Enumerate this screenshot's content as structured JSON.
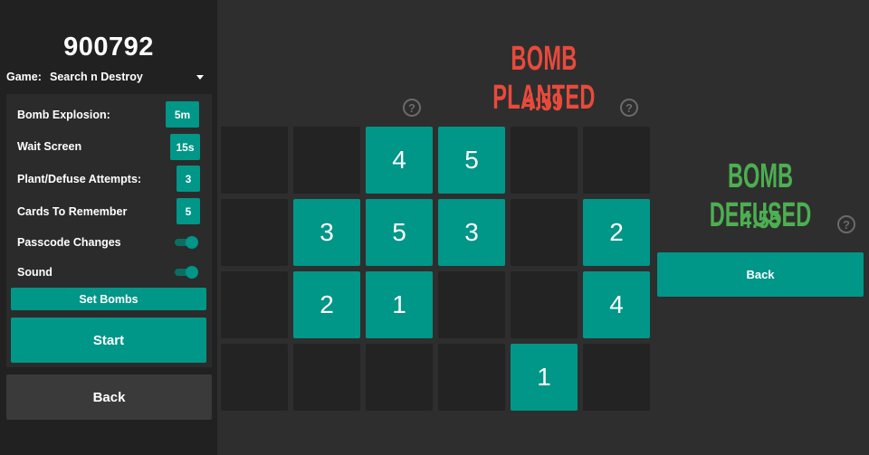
{
  "sidebar": {
    "game_id": "900792",
    "game_label": "Game:",
    "game_value": "Search n Destroy",
    "settings": [
      {
        "label": "Bomb Explosion:",
        "value": "5m"
      },
      {
        "label": "Wait Screen",
        "value": "15s"
      },
      {
        "label": "Plant/Defuse Attempts:",
        "value": "3"
      },
      {
        "label": "Cards To Remember",
        "value": "5"
      }
    ],
    "toggles": [
      {
        "label": "Passcode Changes",
        "on": true
      },
      {
        "label": "Sound",
        "on": true
      }
    ],
    "set_bombs_label": "Set Bombs",
    "start_label": "Start",
    "back_label": "Back"
  },
  "planted": {
    "title": "BOMB PLANTED",
    "timer": "4:59",
    "help": "?"
  },
  "grid": {
    "rows": [
      [
        "",
        "",
        "4",
        "5",
        "",
        ""
      ],
      [
        "",
        "3",
        "5",
        "3",
        "",
        "2"
      ],
      [
        "",
        "2",
        "1",
        "",
        "",
        "4"
      ],
      [
        "",
        "",
        "",
        "",
        "1",
        ""
      ]
    ]
  },
  "defused": {
    "title": "BOMB DEFUSED",
    "timer": "4:55",
    "help": "?",
    "back_label": "Back"
  },
  "colors": {
    "accent": "#009688",
    "planted": "#e84a3c",
    "defused": "#4caf50",
    "background": "#2e2e2e",
    "sidebar": "#212121"
  }
}
